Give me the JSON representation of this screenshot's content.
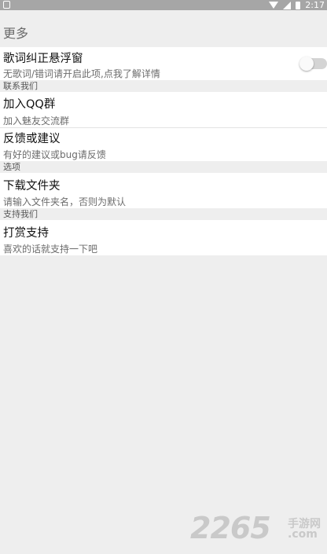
{
  "status_bar": {
    "time": "2:17",
    "icons": [
      "app-notification-icon",
      "wifi-icon",
      "signal-icon",
      "battery-icon"
    ]
  },
  "toolbar": {
    "title": "更多"
  },
  "prefs": {
    "lyrics_window": {
      "title": "歌词纠正悬浮窗",
      "summary": "无歌词/错词请开启此项,点我了解详情",
      "switch_on": false
    },
    "contact_header": "联系我们",
    "join_qq": {
      "title": "加入QQ群",
      "summary": "加入魅友交流群"
    },
    "feedback": {
      "title": "反馈或建议",
      "summary": "有好的建议或bug请反馈"
    },
    "options_header": "选项",
    "download_folder": {
      "title": "下载文件夹",
      "summary": "请输入文件夹名，否则为默认"
    },
    "support_header": "支持我们",
    "donate": {
      "title": "打赏支持",
      "summary": "喜欢的话就支持一下吧"
    }
  },
  "watermark": {
    "number": "2265",
    "cn": "手游网",
    "com": ".com"
  },
  "colors": {
    "background": "#eeeeee",
    "status_bar": "#a6a6a6",
    "item_background": "#ffffff",
    "switch_track": "#d4d4d4"
  }
}
